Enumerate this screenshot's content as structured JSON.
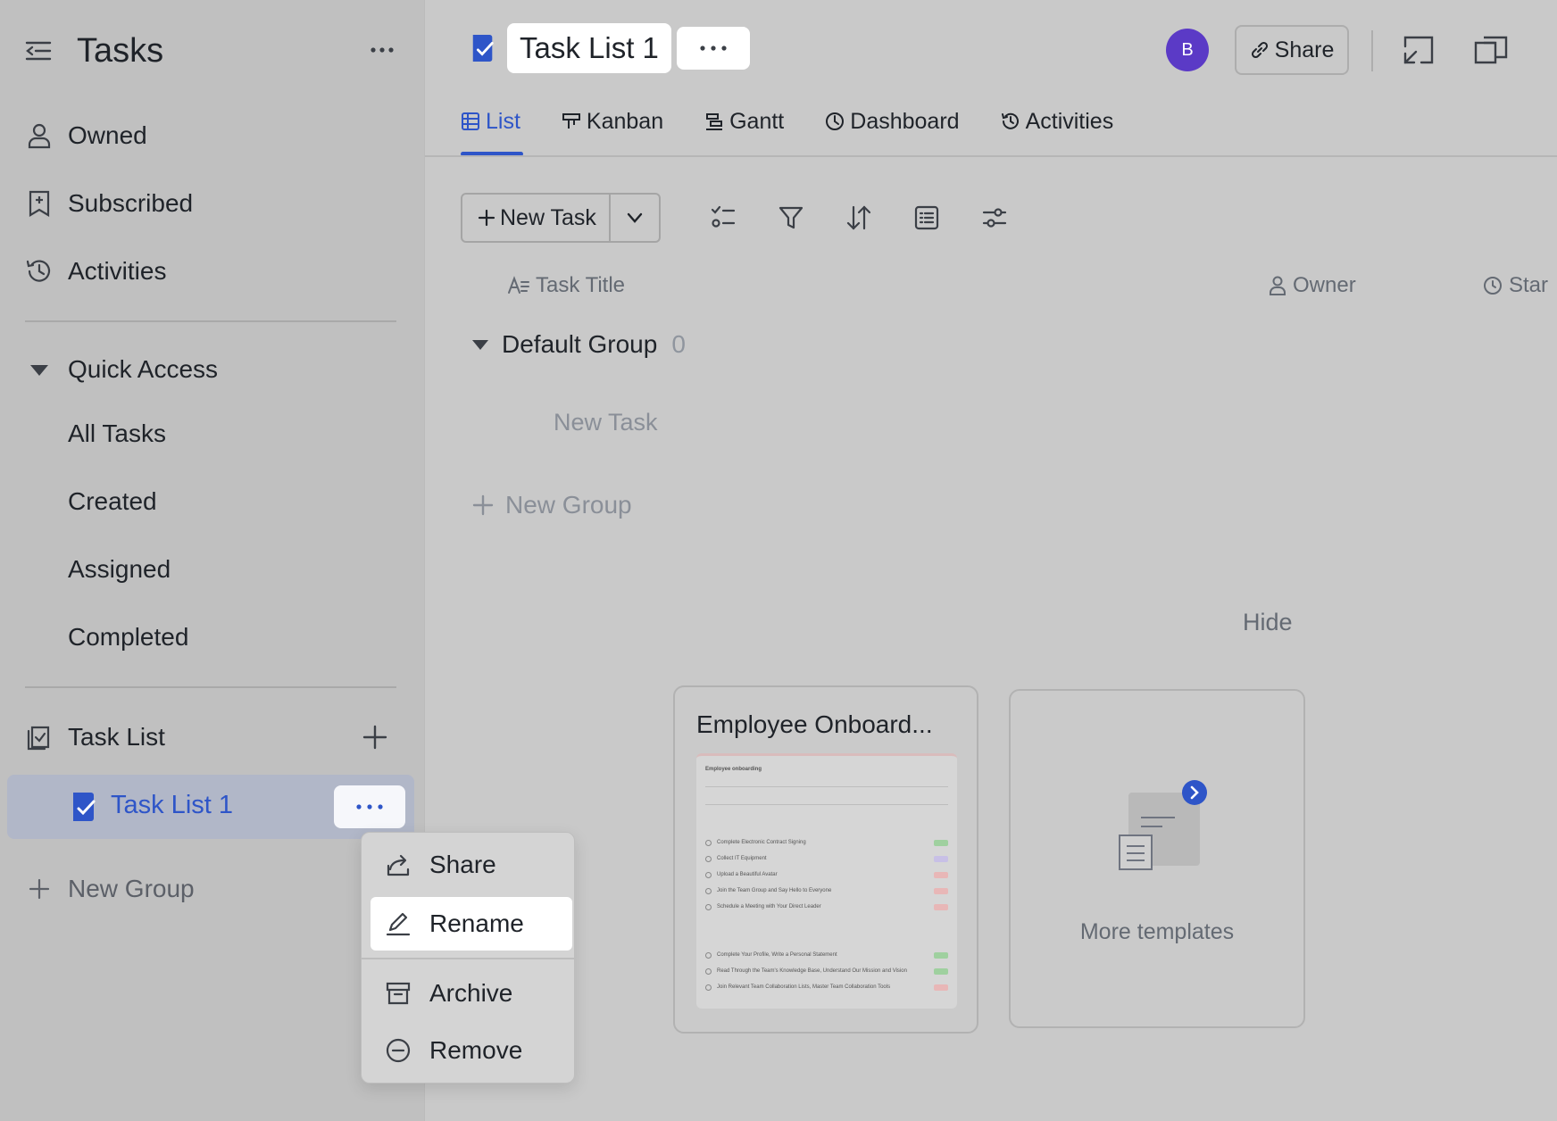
{
  "colors": {
    "accent": "#2e55c8",
    "avatar": "#5b3ac6",
    "muted": "#8a8f98"
  },
  "sidebar": {
    "title": "Tasks",
    "items": [
      {
        "label": "Owned",
        "icon": "person-icon"
      },
      {
        "label": "Subscribed",
        "icon": "bookmark-icon"
      },
      {
        "label": "Activities",
        "icon": "history-icon"
      }
    ],
    "quick_access": {
      "label": "Quick Access",
      "items": [
        "All Tasks",
        "Created",
        "Assigned",
        "Completed"
      ]
    },
    "task_list_section": {
      "label": "Task List"
    },
    "active_list": {
      "label": "Task List 1"
    },
    "new_group": "New Group"
  },
  "context_menu": {
    "items": [
      {
        "label": "Share",
        "icon": "share-icon"
      },
      {
        "label": "Rename",
        "icon": "pencil-icon"
      },
      {
        "label": "Archive",
        "icon": "archive-icon"
      },
      {
        "label": "Remove",
        "icon": "remove-icon"
      }
    ],
    "highlighted": "Rename"
  },
  "header": {
    "title": "Task List 1",
    "avatar_initial": "B",
    "share_label": "Share"
  },
  "tabs": [
    {
      "label": "List",
      "icon": "table-icon",
      "active": true
    },
    {
      "label": "Kanban",
      "icon": "kanban-icon"
    },
    {
      "label": "Gantt",
      "icon": "gantt-icon"
    },
    {
      "label": "Dashboard",
      "icon": "dashboard-icon"
    },
    {
      "label": "Activities",
      "icon": "history-icon"
    }
  ],
  "toolbar": {
    "new_task": "New Task",
    "tools": [
      "checklist-icon",
      "filter-icon",
      "sort-icon",
      "group-icon",
      "settings-icon"
    ]
  },
  "table": {
    "columns": [
      {
        "label": "Task Title",
        "icon": "text-icon"
      },
      {
        "label": "Owner",
        "icon": "person-icon"
      },
      {
        "label": "Star",
        "icon": "clock-icon"
      }
    ]
  },
  "group": {
    "name": "Default Group",
    "count": "0",
    "new_task": "New Task"
  },
  "new_group": "New Group",
  "templates": {
    "hide_label": "Hide",
    "cards": [
      {
        "title": "Employee Onboard...",
        "preview": {
          "header": "Employee onboarding",
          "rows": [
            "Complete Electronic Contract Signing",
            "Collect IT Equipment",
            "Upload a Beautiful Avatar",
            "Join the Team Group and Say Hello to Everyone",
            "Schedule a Meeting with Your Direct Leader",
            "Complete Your Profile, Write a Personal Statement",
            "Read Through the Team's Knowledge Base, Understand Our Mission and Vision",
            "Join Relevant Team Collaboration Lists, Master Team Collaboration Tools"
          ]
        }
      }
    ],
    "more_label": "More templates"
  }
}
